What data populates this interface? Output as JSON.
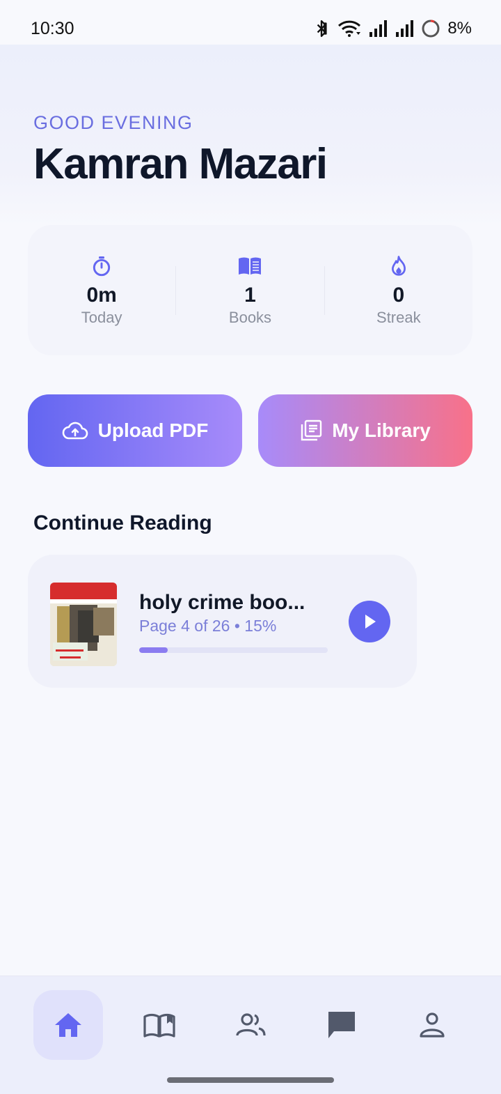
{
  "status_bar": {
    "time": "10:30",
    "battery": "8%"
  },
  "header": {
    "greeting": "GOOD EVENING",
    "user_name": "Kamran Mazari"
  },
  "stats": [
    {
      "icon": "stopwatch-icon",
      "value": "0m",
      "label": "Today"
    },
    {
      "icon": "open-book-icon",
      "value": "1",
      "label": "Books"
    },
    {
      "icon": "flame-icon",
      "value": "0",
      "label": "Streak"
    }
  ],
  "actions": {
    "upload_label": "Upload PDF",
    "library_label": "My Library"
  },
  "continue_reading": {
    "title": "Continue Reading",
    "book": {
      "title": "holy crime boo...",
      "meta": "Page 4 of 26 • 15%",
      "progress": 0.15
    }
  },
  "nav": [
    {
      "name": "home",
      "icon": "home-icon",
      "active": true
    },
    {
      "name": "library",
      "icon": "book-icon",
      "active": false
    },
    {
      "name": "community",
      "icon": "people-icon",
      "active": false
    },
    {
      "name": "chat",
      "icon": "chat-icon",
      "active": false
    },
    {
      "name": "profile",
      "icon": "profile-icon",
      "active": false
    }
  ],
  "colors": {
    "accent": "#6366f1",
    "accent_light": "#a78bfa",
    "pink": "#f87189",
    "text_dark": "#0f172a",
    "muted": "#8a8f9c"
  }
}
